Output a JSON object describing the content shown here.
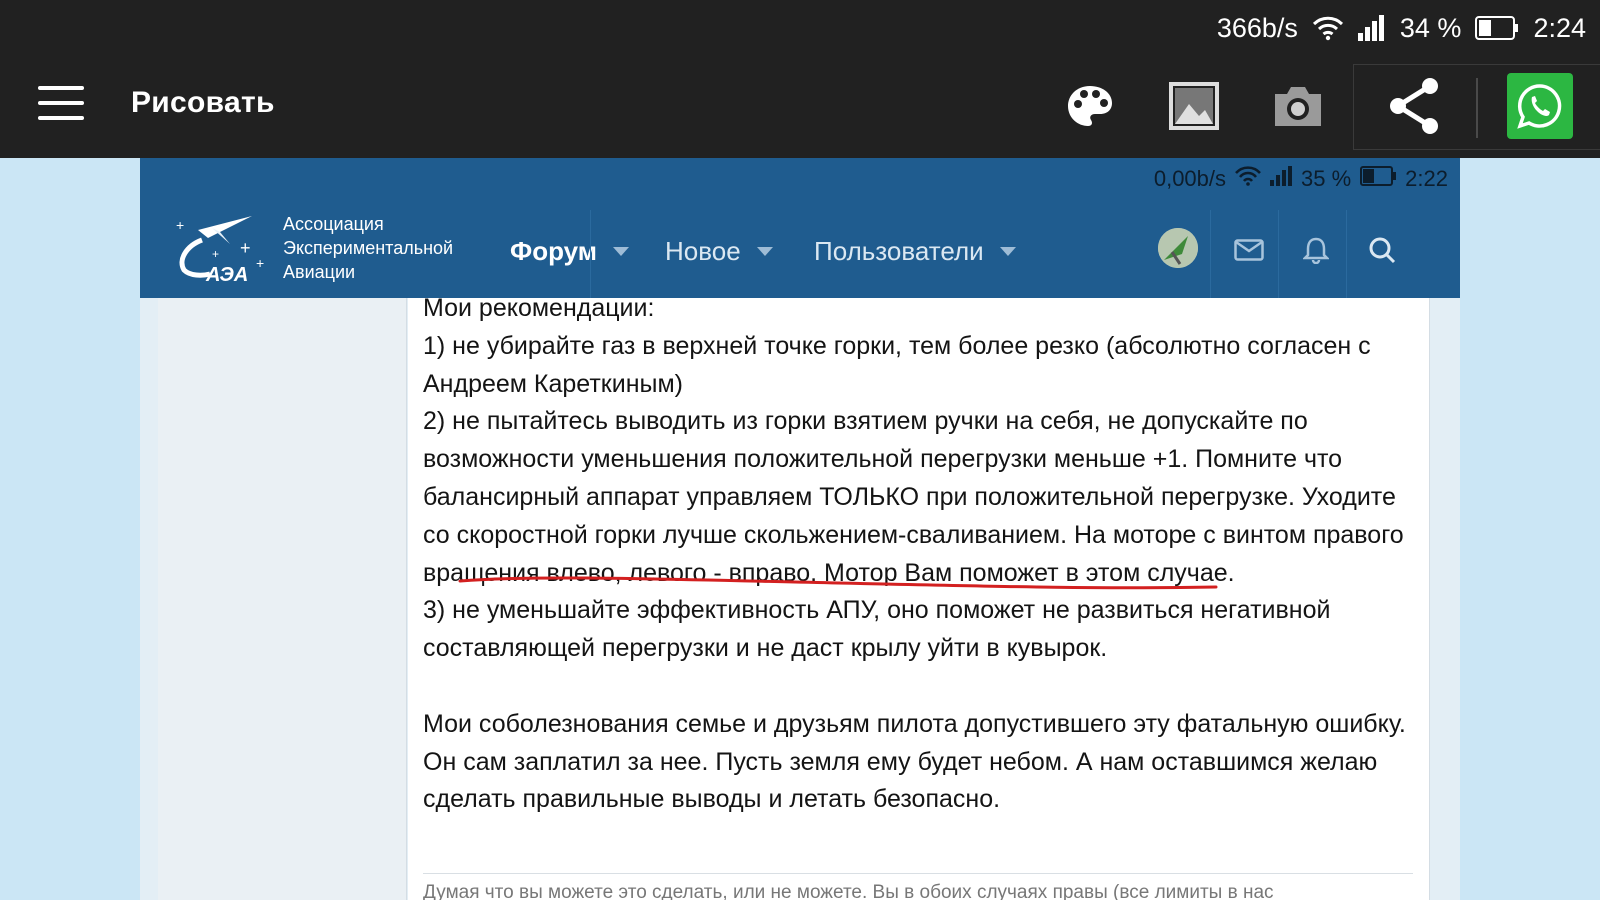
{
  "outer_status": {
    "speed": "366b/s",
    "battery_percent": "34 %",
    "time": "2:24"
  },
  "toolbar": {
    "title": "Рисовать",
    "icons": [
      "menu-icon",
      "palette-icon",
      "image-icon",
      "camera-icon",
      "share-icon",
      "whatsapp-icon"
    ],
    "whatsapp_color": "#2cb742"
  },
  "inner_status": {
    "speed": "0,00b/s",
    "battery_percent": "35 %",
    "time": "2:22"
  },
  "site": {
    "logo_line1": "Ассоциация",
    "logo_line2": "Экспериментальной",
    "logo_line3": "Авиации",
    "logo_abbr": "АЭА",
    "header_color": "#1f5c8f",
    "nav": [
      {
        "label": "Форум"
      },
      {
        "label": "Новое"
      },
      {
        "label": "Пользователи"
      }
    ]
  },
  "post": {
    "paragraphs": [
      "Мои рекомендации:",
      "1) не убирайте газ в верхней точке горки, тем более резко (абсолютно согласен с Андреем Кареткиным)",
      "2) не пытайтесь выводить из горки взятием ручки на себя, не допускайте по возможности уменьшения положительной перегрузки меньше +1. Помните что балансирный аппарат управляем ТОЛЬКО при положительной перегрузке. Уходите со скоростной горки лучше скольжением-сваливанием. На моторе с винтом правого вращения влево, левого - вправо. Мотор Вам поможет в этом случае.",
      "3) не уменьшайте эффективность АПУ, оно поможет не развиться негативной составляющей перегрузки и не даст крылу уйти в кувырок.",
      "",
      "Мои соболезнования семье и друзьям пилота допустившего эту фатальную ошибку. Он сам заплатил за нее. Пусть земля ему будет небом. А нам оставшимся желаю сделать правильные выводы и летать безопасно."
    ],
    "signature": "Думая что вы можете это сделать, или не можете. Вы в обоих случаях правы (все лимиты в нас",
    "annotation_color": "#d32020"
  }
}
